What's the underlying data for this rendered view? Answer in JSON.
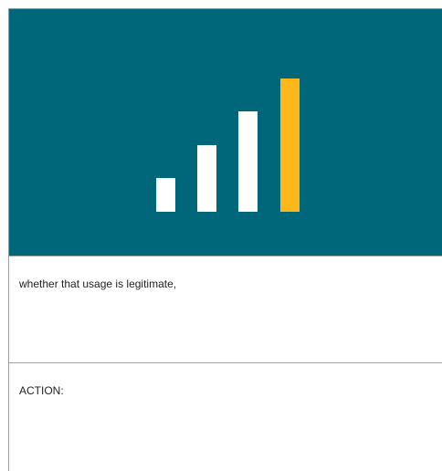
{
  "hero": {
    "background": "#00677b",
    "icon": "signal-strength-bars-icon",
    "bar_levels": [
      0.25,
      0.5,
      0.75,
      1.0
    ],
    "bar_colors": [
      "#ffffff",
      "#ffffff",
      "#ffffff",
      "#fdb71a"
    ]
  },
  "sections": [
    {
      "text": "whether that usage is legitimate,"
    },
    {
      "text": "ACTION:"
    }
  ]
}
